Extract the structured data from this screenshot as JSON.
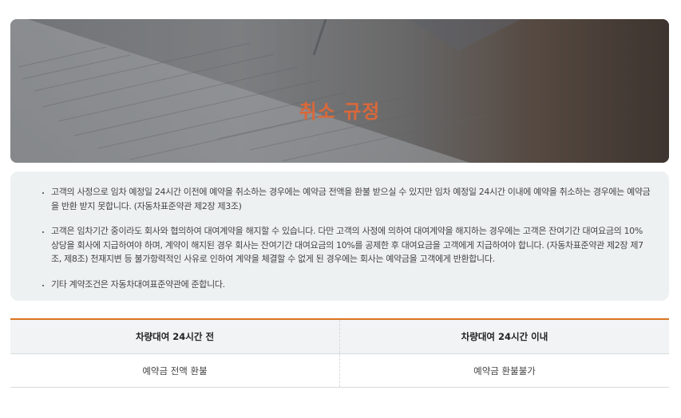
{
  "hero": {
    "title": "취소 규정"
  },
  "notes": [
    "고객의 사정으로 임차 예정일 24시간 이전에 예약을 취소하는 경우에는 예약금 전액을 환불 받으실 수 있지만 임차 예정일 24시간 이내에 예약을 취소하는 경우에는 예약금을 반환 받지 못합니다. (자동차표준약관 제2장 제3조)",
    "고객은 임차기간 중이라도 회사와 협의하여 대여계약을 해지할 수 있습니다. 다만 고객의 사정에 의하여 대여계약을 해지하는 경우에는 고객은 잔여기간 대여요금의 10% 상당을 회사에 지급하여야 하며, 계약이 해지된 경우 회사는 잔여기간 대여요금의 10%를 공제한 후 대여요금을 고객에게 지급하여야 합니다. (자동차표준약관 제2장 제7조, 제8조) 천재지변 등 불가항력적인 사유로 인하여 계약을 체결할 수 없게 된 경우에는 회사는 예약금을 고객에게 반환합니다.",
    "기타 계약조건은 자동차대여표준약관에 준합니다."
  ],
  "table": {
    "headers": [
      "차량대여 24시간 전",
      "차량대여 24시간 이내"
    ],
    "row": [
      "예약금 전액 환불",
      "예약금 환불불가"
    ]
  },
  "colors": {
    "accent": "#d9741f",
    "title": "#d9683a",
    "panel": "#eef1f2"
  }
}
